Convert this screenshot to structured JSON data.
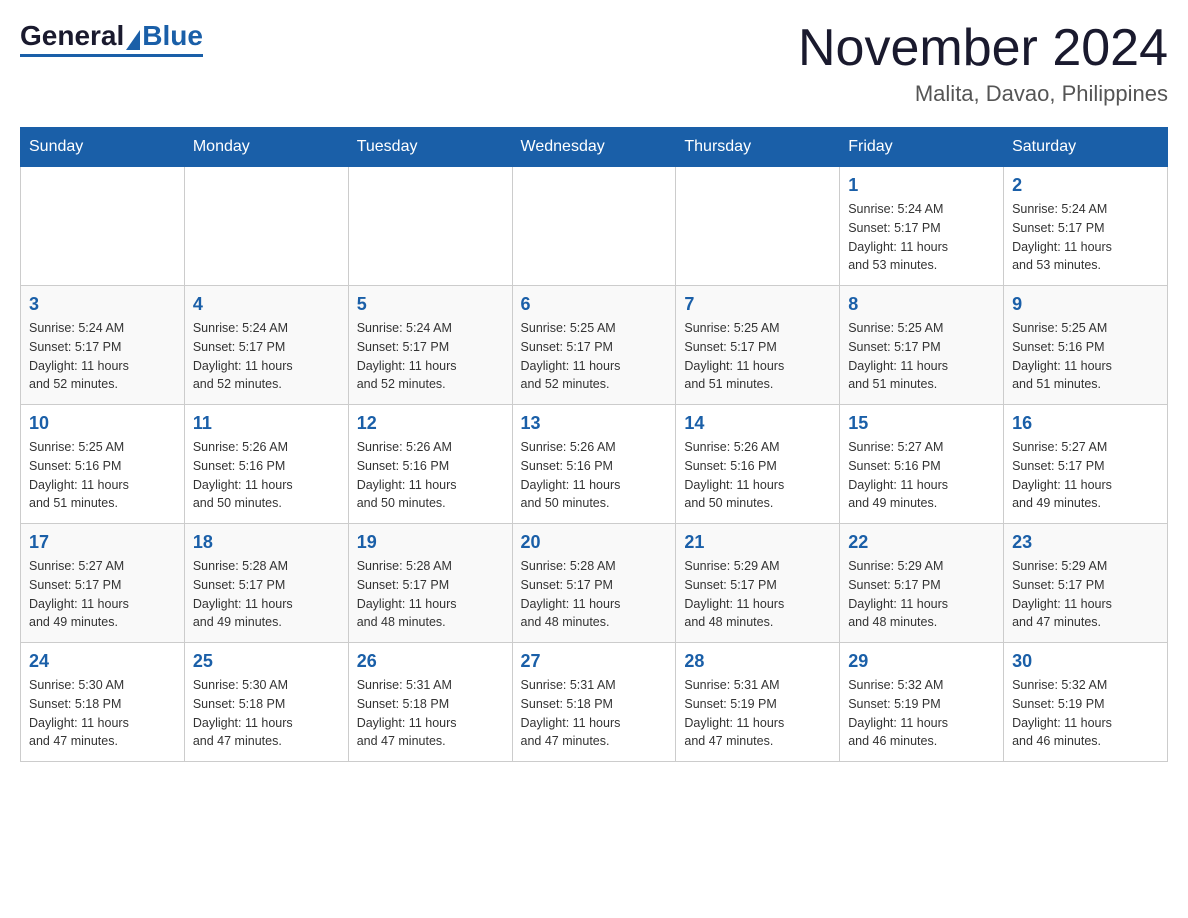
{
  "header": {
    "logo": {
      "general": "General",
      "blue": "Blue"
    },
    "title": "November 2024",
    "location": "Malita, Davao, Philippines"
  },
  "days_of_week": [
    "Sunday",
    "Monday",
    "Tuesday",
    "Wednesday",
    "Thursday",
    "Friday",
    "Saturday"
  ],
  "weeks": [
    {
      "days": [
        {
          "number": "",
          "info": ""
        },
        {
          "number": "",
          "info": ""
        },
        {
          "number": "",
          "info": ""
        },
        {
          "number": "",
          "info": ""
        },
        {
          "number": "",
          "info": ""
        },
        {
          "number": "1",
          "info": "Sunrise: 5:24 AM\nSunset: 5:17 PM\nDaylight: 11 hours\nand 53 minutes."
        },
        {
          "number": "2",
          "info": "Sunrise: 5:24 AM\nSunset: 5:17 PM\nDaylight: 11 hours\nand 53 minutes."
        }
      ]
    },
    {
      "days": [
        {
          "number": "3",
          "info": "Sunrise: 5:24 AM\nSunset: 5:17 PM\nDaylight: 11 hours\nand 52 minutes."
        },
        {
          "number": "4",
          "info": "Sunrise: 5:24 AM\nSunset: 5:17 PM\nDaylight: 11 hours\nand 52 minutes."
        },
        {
          "number": "5",
          "info": "Sunrise: 5:24 AM\nSunset: 5:17 PM\nDaylight: 11 hours\nand 52 minutes."
        },
        {
          "number": "6",
          "info": "Sunrise: 5:25 AM\nSunset: 5:17 PM\nDaylight: 11 hours\nand 52 minutes."
        },
        {
          "number": "7",
          "info": "Sunrise: 5:25 AM\nSunset: 5:17 PM\nDaylight: 11 hours\nand 51 minutes."
        },
        {
          "number": "8",
          "info": "Sunrise: 5:25 AM\nSunset: 5:17 PM\nDaylight: 11 hours\nand 51 minutes."
        },
        {
          "number": "9",
          "info": "Sunrise: 5:25 AM\nSunset: 5:16 PM\nDaylight: 11 hours\nand 51 minutes."
        }
      ]
    },
    {
      "days": [
        {
          "number": "10",
          "info": "Sunrise: 5:25 AM\nSunset: 5:16 PM\nDaylight: 11 hours\nand 51 minutes."
        },
        {
          "number": "11",
          "info": "Sunrise: 5:26 AM\nSunset: 5:16 PM\nDaylight: 11 hours\nand 50 minutes."
        },
        {
          "number": "12",
          "info": "Sunrise: 5:26 AM\nSunset: 5:16 PM\nDaylight: 11 hours\nand 50 minutes."
        },
        {
          "number": "13",
          "info": "Sunrise: 5:26 AM\nSunset: 5:16 PM\nDaylight: 11 hours\nand 50 minutes."
        },
        {
          "number": "14",
          "info": "Sunrise: 5:26 AM\nSunset: 5:16 PM\nDaylight: 11 hours\nand 50 minutes."
        },
        {
          "number": "15",
          "info": "Sunrise: 5:27 AM\nSunset: 5:16 PM\nDaylight: 11 hours\nand 49 minutes."
        },
        {
          "number": "16",
          "info": "Sunrise: 5:27 AM\nSunset: 5:17 PM\nDaylight: 11 hours\nand 49 minutes."
        }
      ]
    },
    {
      "days": [
        {
          "number": "17",
          "info": "Sunrise: 5:27 AM\nSunset: 5:17 PM\nDaylight: 11 hours\nand 49 minutes."
        },
        {
          "number": "18",
          "info": "Sunrise: 5:28 AM\nSunset: 5:17 PM\nDaylight: 11 hours\nand 49 minutes."
        },
        {
          "number": "19",
          "info": "Sunrise: 5:28 AM\nSunset: 5:17 PM\nDaylight: 11 hours\nand 48 minutes."
        },
        {
          "number": "20",
          "info": "Sunrise: 5:28 AM\nSunset: 5:17 PM\nDaylight: 11 hours\nand 48 minutes."
        },
        {
          "number": "21",
          "info": "Sunrise: 5:29 AM\nSunset: 5:17 PM\nDaylight: 11 hours\nand 48 minutes."
        },
        {
          "number": "22",
          "info": "Sunrise: 5:29 AM\nSunset: 5:17 PM\nDaylight: 11 hours\nand 48 minutes."
        },
        {
          "number": "23",
          "info": "Sunrise: 5:29 AM\nSunset: 5:17 PM\nDaylight: 11 hours\nand 47 minutes."
        }
      ]
    },
    {
      "days": [
        {
          "number": "24",
          "info": "Sunrise: 5:30 AM\nSunset: 5:18 PM\nDaylight: 11 hours\nand 47 minutes."
        },
        {
          "number": "25",
          "info": "Sunrise: 5:30 AM\nSunset: 5:18 PM\nDaylight: 11 hours\nand 47 minutes."
        },
        {
          "number": "26",
          "info": "Sunrise: 5:31 AM\nSunset: 5:18 PM\nDaylight: 11 hours\nand 47 minutes."
        },
        {
          "number": "27",
          "info": "Sunrise: 5:31 AM\nSunset: 5:18 PM\nDaylight: 11 hours\nand 47 minutes."
        },
        {
          "number": "28",
          "info": "Sunrise: 5:31 AM\nSunset: 5:19 PM\nDaylight: 11 hours\nand 47 minutes."
        },
        {
          "number": "29",
          "info": "Sunrise: 5:32 AM\nSunset: 5:19 PM\nDaylight: 11 hours\nand 46 minutes."
        },
        {
          "number": "30",
          "info": "Sunrise: 5:32 AM\nSunset: 5:19 PM\nDaylight: 11 hours\nand 46 minutes."
        }
      ]
    }
  ]
}
